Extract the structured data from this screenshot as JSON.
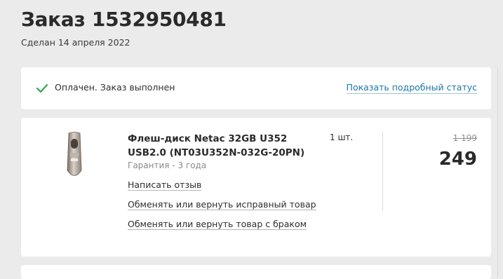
{
  "order": {
    "title": "Заказ 1532950481",
    "date": "Сделан 14 апреля 2022"
  },
  "status": {
    "icon": "check-icon",
    "icon_color": "#2fa84f",
    "text": "Оплачен. Заказ выполнен",
    "link": "Показать подробный статус"
  },
  "item": {
    "name": "Флеш-диск Netac 32GB U352 USB2.0 (NT03U352N-032G-20PN)",
    "warranty": "Гарантия - 3 года",
    "actions": [
      "Написать отзыв",
      "Обменять или вернуть исправный товар",
      "Обменять или вернуть товар с браком"
    ],
    "quantity": "1 шт.",
    "old_price": "1 199",
    "price": "249"
  },
  "colors": {
    "link": "#1a76a8",
    "background": "#ebebeb"
  }
}
